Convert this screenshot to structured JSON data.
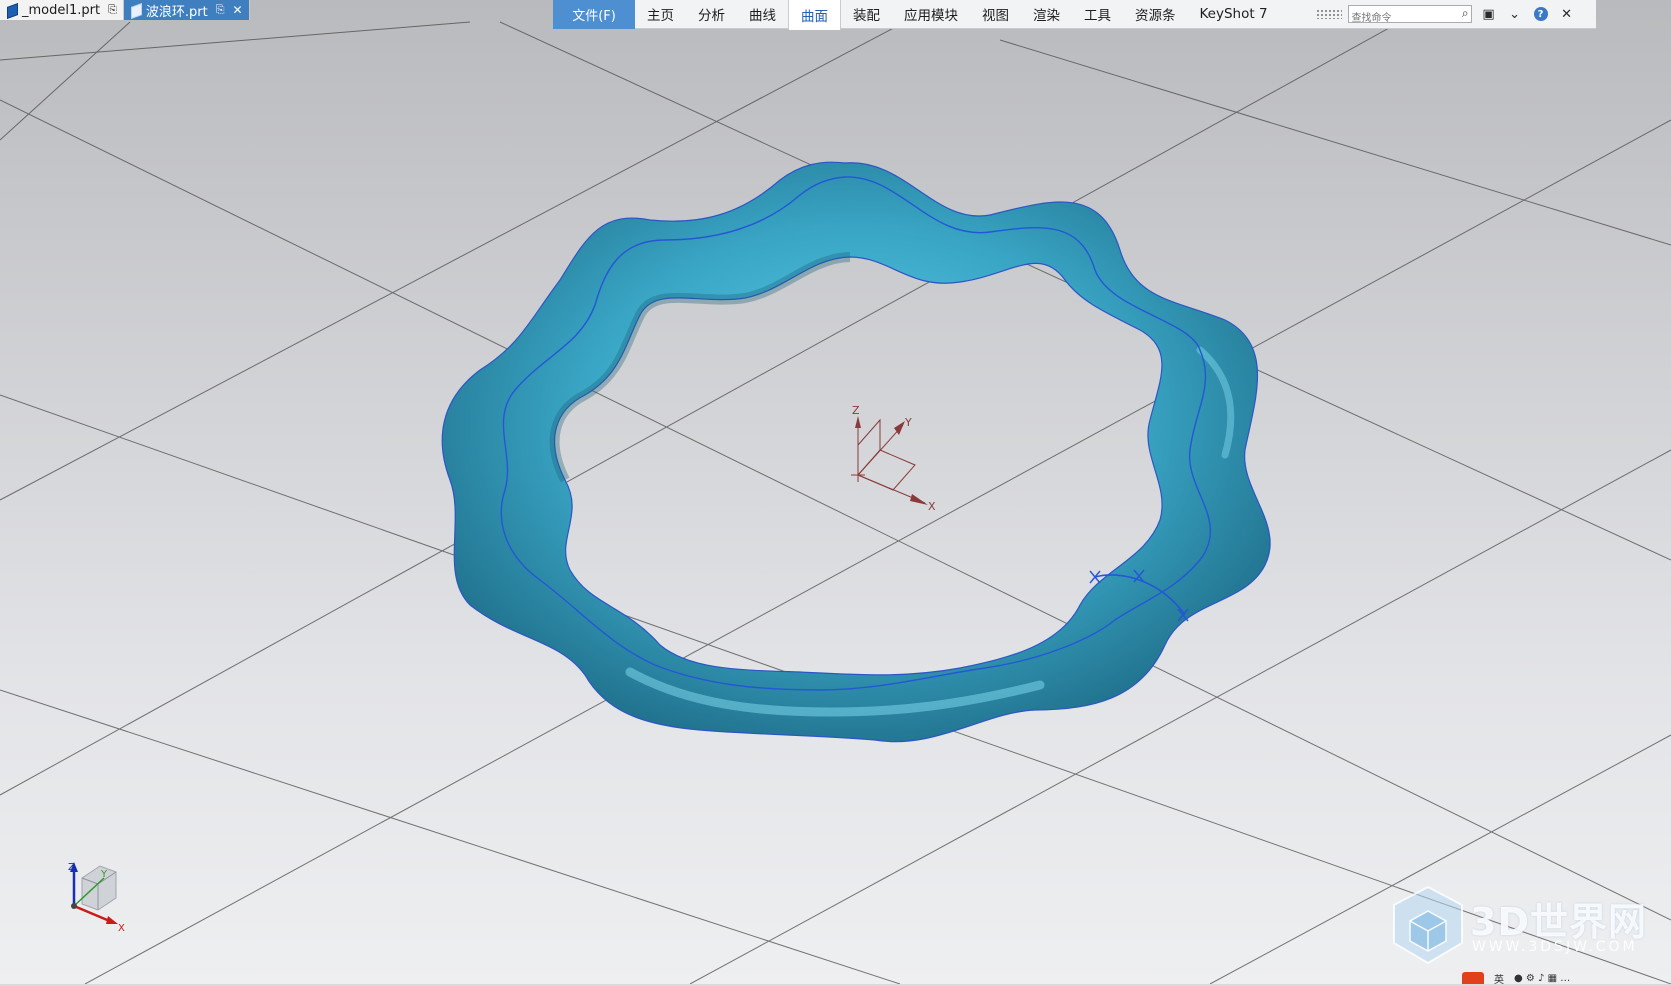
{
  "document_tabs": [
    {
      "label": "_model1.prt",
      "active": false
    },
    {
      "label": "波浪环.prt",
      "active": true
    }
  ],
  "menu": {
    "file": "文件(F)",
    "items": [
      "主页",
      "分析",
      "曲线",
      "曲面",
      "装配",
      "应用模块",
      "视图",
      "渲染",
      "工具",
      "资源条",
      "KeyShot 7"
    ],
    "active_item": "曲面",
    "search_placeholder": "查找命令"
  },
  "triad": {
    "x": "X",
    "y": "Y",
    "z": "Z"
  },
  "csys": {
    "x": "X",
    "y": "Y",
    "z": "Z"
  },
  "watermark": {
    "text": "3D世界网",
    "url": "WWW.3DSJW.COM"
  },
  "taskbar": {
    "ime": "英"
  },
  "colors": {
    "part": "#3fa9c9",
    "curve": "#2457d6",
    "accent": "#4d8fd0"
  }
}
